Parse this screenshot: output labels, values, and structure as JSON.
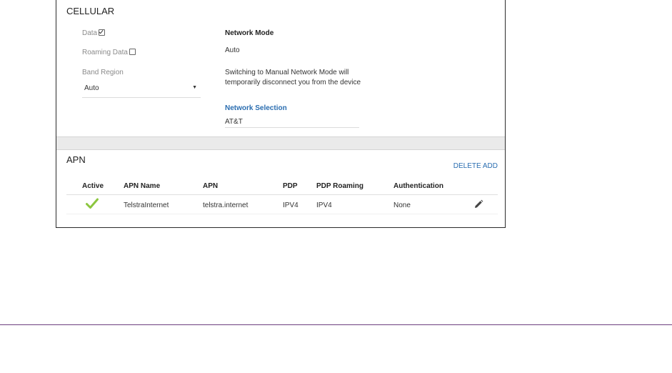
{
  "cellular": {
    "title": "CELLULAR",
    "data_label": "Data",
    "data_checked": true,
    "roaming_label": "Roaming Data",
    "roaming_checked": false,
    "band_region_label": "Band Region",
    "band_region_value": "Auto",
    "network_mode_label": "Network Mode",
    "network_mode_value": "Auto",
    "network_mode_note": "Switching to Manual Network Mode will temporarily disconnect you from the device",
    "network_selection_label": "Network Selection",
    "network_selection_value": "AT&T"
  },
  "apn": {
    "title": "APN",
    "delete_label": "DELETE",
    "add_label": "ADD",
    "columns": [
      "Active",
      "APN Name",
      "APN",
      "PDP",
      "PDP Roaming",
      "Authentication"
    ],
    "rows": [
      {
        "active": true,
        "apn_name": "TelstraInternet",
        "apn": "telstra.internet",
        "pdp": "IPV4",
        "pdp_roaming": "IPV4",
        "authentication": "None"
      }
    ]
  },
  "colors": {
    "accent": "#2a6db0",
    "check": "#8cc63f",
    "rule": "#6d3e7e"
  },
  "icons": [
    "checkbox-checked-icon",
    "checkbox-unchecked-icon",
    "dropdown-arrow-icon",
    "active-check-icon",
    "edit-pencil-icon"
  ]
}
